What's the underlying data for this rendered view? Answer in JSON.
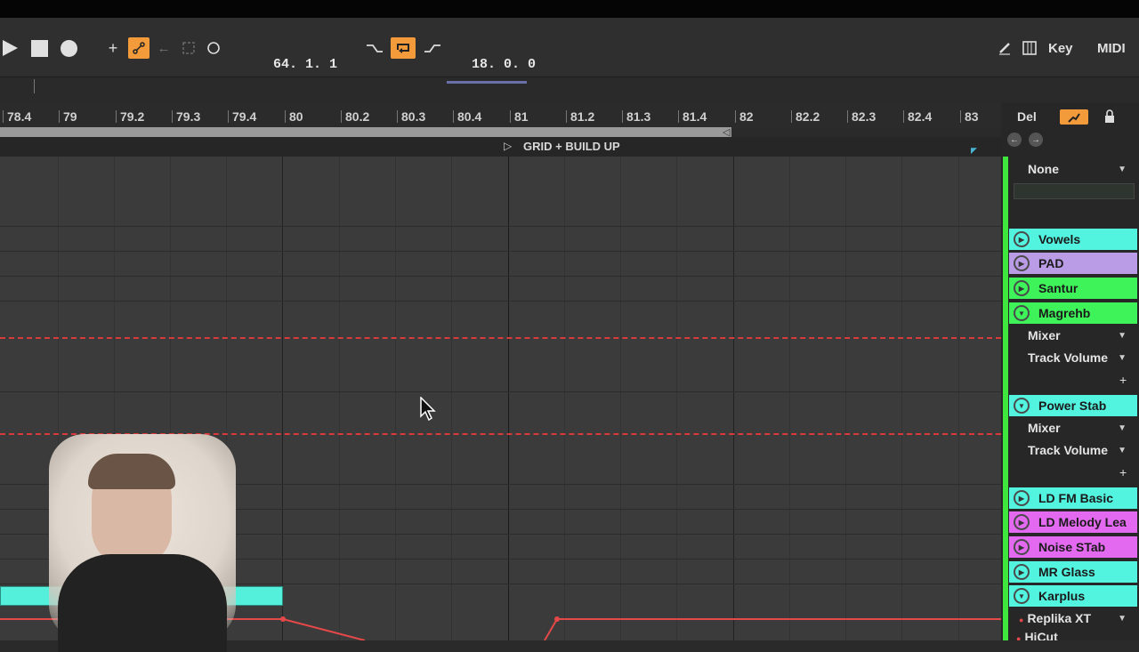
{
  "transport": {
    "position": "64.  1.  1",
    "loop_length": "18.  0.  0",
    "key_label": "Key",
    "midi_label": "MIDI"
  },
  "ruler": {
    "ticks": [
      "78.4",
      "79",
      "79.2",
      "79.3",
      "79.4",
      "80",
      "80.2",
      "80.3",
      "80.4",
      "81",
      "81.2",
      "81.3",
      "81.4",
      "82",
      "82.2",
      "82.3",
      "82.4",
      "83"
    ]
  },
  "locator": {
    "label": "GRID + BUILD UP"
  },
  "right_panel": {
    "del_label": "Del",
    "none_dropdown": "None",
    "tracks": [
      {
        "name": "Vowels",
        "color": "#52f4e0"
      },
      {
        "name": "PAD",
        "color": "#b99be6"
      },
      {
        "name": "Santur",
        "color": "#3ef25a"
      },
      {
        "name": "Magrehb",
        "color": "#3ef25a"
      },
      {
        "name": "Power Stab",
        "color": "#52f4e0"
      },
      {
        "name": "LD FM Basic",
        "color": "#52f4e0"
      },
      {
        "name": "LD Melody Lea",
        "color": "#e36af0"
      },
      {
        "name": "Noise STab",
        "color": "#e36af0"
      },
      {
        "name": "MR Glass",
        "color": "#52f4e0"
      },
      {
        "name": "Karplus",
        "color": "#52f4e0"
      }
    ],
    "mixer_label": "Mixer",
    "track_volume_label": "Track Volume",
    "replika_label": "Replika XT",
    "hicut_label": "HiCut"
  }
}
